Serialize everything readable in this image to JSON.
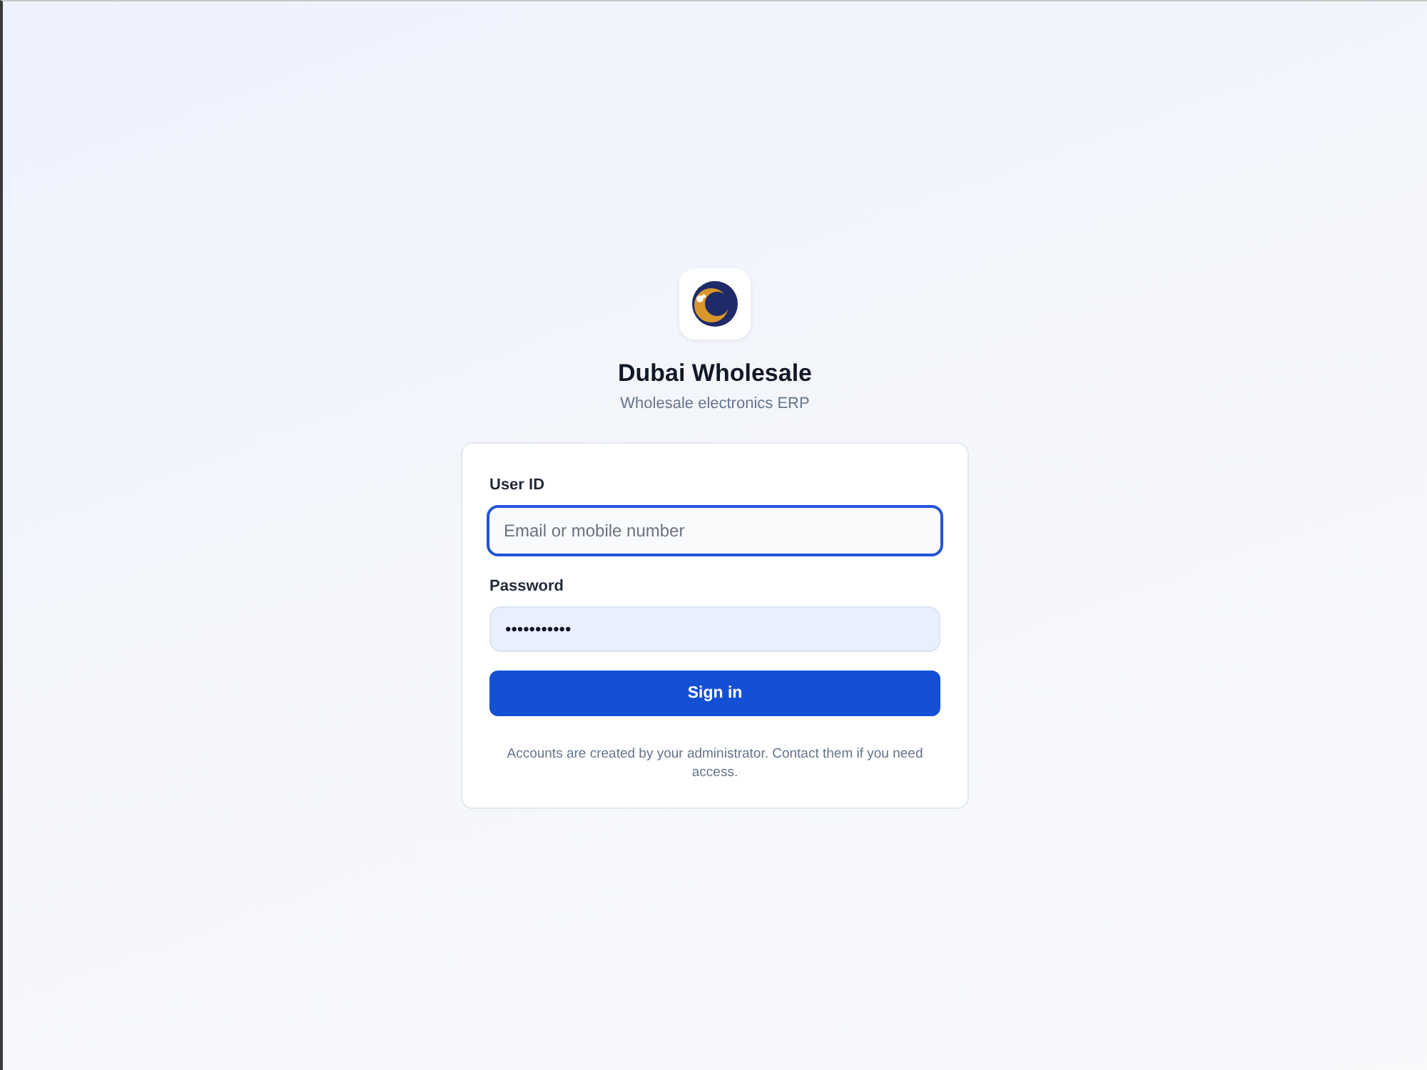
{
  "brand": {
    "title": "Dubai Wholesale",
    "subtitle": "Wholesale electronics ERP"
  },
  "form": {
    "fields": [
      {
        "label": "User ID",
        "placeholder": "Email or mobile number",
        "focused": true,
        "autofilled": false
      },
      {
        "label": "Password",
        "value": "•••••••••••",
        "focused": false,
        "autofilled": true
      }
    ],
    "submit": "Sign in",
    "note": "Accounts are created by your administrator. Contact them if you need access."
  }
}
